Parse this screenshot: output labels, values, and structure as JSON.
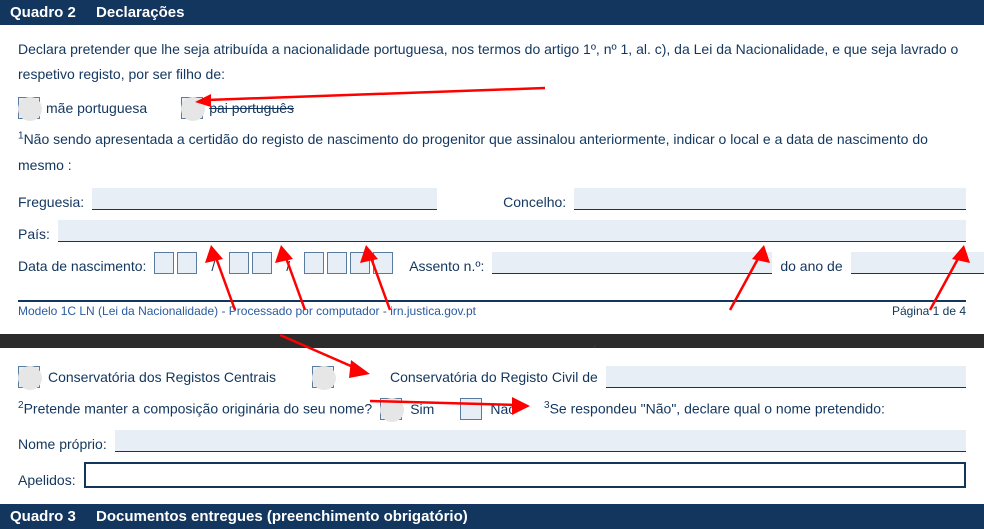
{
  "quadro2": {
    "header_num": "Quadro 2",
    "header_title": "Declarações",
    "declaration_text": "Declara pretender que lhe seja atribuída a nacionalidade portuguesa, nos termos do artigo 1º, nº 1, al. c), da Lei da Nacionalidade, e que seja lavrado o respetivo registo, por ser filho de:",
    "chk_mae": "mãe portuguesa",
    "chk_pai": "pai português",
    "note1": "Não sendo apresentada a certidão do registo de nascimento do progenitor que assinalou anteriormente, indicar o local e a data de nascimento do mesmo :",
    "freguesia_lbl": "Freguesia:",
    "concelho_lbl": "Concelho:",
    "pais_lbl": "País:",
    "dob_lbl": "Data de nascimento:",
    "assento_lbl": "Assento n.º:",
    "ano_lbl": "do ano de",
    "footer_left": "Modelo 1C LN (Lei da Nacionalidade) - Processado por computador - irn.justica.gov.pt",
    "footer_right": "Página 1 de 4"
  },
  "block2": {
    "chk_crc": "Conservatória dos Registos Centrais",
    "chk_crcivil": "Conservatória do Registo Civil de",
    "q2_text": "Pretende manter a composição originária  do seu nome?",
    "sim": "Sim",
    "nao": "Não",
    "q3_text": "Se respondeu \"Não\", declare qual o nome pretendido:",
    "nome_proprio": "Nome próprio:",
    "apelidos": "Apelidos:"
  },
  "quadro3": {
    "header_num": "Quadro 3",
    "header_title": "Documentos entregues (preenchimento obrigatório)"
  }
}
